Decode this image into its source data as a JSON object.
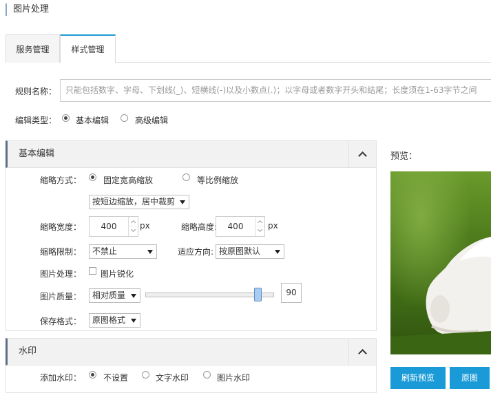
{
  "page_title": "图片处理",
  "tabs": [
    "服务管理",
    "样式管理"
  ],
  "rule_name": {
    "label": "规则名称：",
    "placeholder": "只能包括数字、字母、下划线(_)、短横线(-)以及小数点(.)；以字母或者数字开头和结尾；长度须在1-63字节之间"
  },
  "edit_type": {
    "label": "编辑类型：",
    "options": [
      "基本编辑",
      "高级编辑"
    ],
    "selected": "基本编辑"
  },
  "basic": {
    "title": "基本编辑",
    "scale_mode_label": "缩略方式：",
    "scale_modes": [
      "固定宽高缩放",
      "等比例缩放"
    ],
    "scale_mode_selected": "固定宽高缩放",
    "crop_select": "按短边缩放，居中裁剪",
    "width_label": "缩略宽度：",
    "width_value": "400",
    "height_label": "缩略高度:",
    "height_value": "400",
    "unit": "px",
    "limit_label": "缩略限制：",
    "limit_value": "不禁止",
    "orient_label": "适应方向:",
    "orient_value": "按原图默认",
    "process_label": "图片处理：",
    "sharpen_label": "图片锐化",
    "quality_label": "图片质量：",
    "quality_mode": "相对质量",
    "quality_value": 90,
    "quality_value_text": "90",
    "format_label": "保存格式：",
    "format_value": "原图格式"
  },
  "watermark": {
    "title": "水印",
    "add_label": "添加水印：",
    "options": [
      "不设置",
      "文字水印",
      "图片水印"
    ],
    "selected": "不设置"
  },
  "preview": {
    "label": "预览：",
    "refresh_button": "刷新预览",
    "original_button": "原图"
  },
  "colors": {
    "accent": "#1a9bd7",
    "panel_header_bg": "#f2f2f2"
  }
}
